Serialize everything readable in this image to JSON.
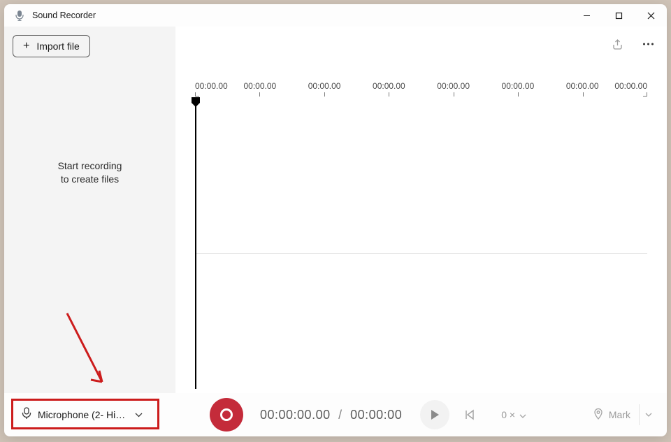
{
  "titlebar": {
    "title": "Sound Recorder"
  },
  "sidebar": {
    "import_label": "Import file",
    "empty_line1": "Start recording",
    "empty_line2": "to create files"
  },
  "timeline": {
    "ticks": [
      "00:00.00",
      "00:00.00",
      "00:00.00",
      "00:00.00",
      "00:00.00",
      "00:00.00",
      "00:00.00",
      "00:00.00"
    ]
  },
  "bottombar": {
    "mic_label": "Microphone (2- High...",
    "elapsed": "00:00:00.00",
    "total": "00:00:00",
    "speed_label": "0 ×",
    "mark_label": "Mark"
  },
  "colors": {
    "record_red": "#c42b3a",
    "highlight_red": "#cc1c1c"
  }
}
